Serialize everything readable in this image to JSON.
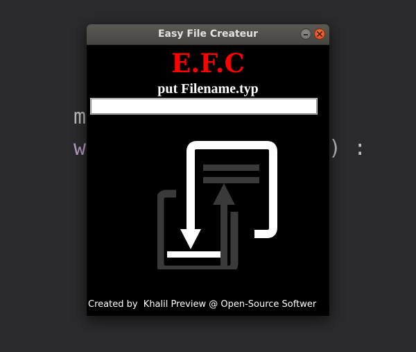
{
  "background": {
    "line1_left": "m",
    "line2_left": "w",
    "line2_right": ") :"
  },
  "window": {
    "title": "Easy File Createur",
    "app_title": "E.F.C",
    "prompt": "put  Filename.typ",
    "filename_input": {
      "value": "",
      "placeholder": ""
    },
    "footer": "Created by  Khalil Preview @ Open-Source Softwer",
    "controls": [
      "minimize-icon",
      "close-icon"
    ]
  },
  "colors": {
    "app_title": "#ff0000",
    "window_bg": "#000000",
    "close_button": "#e0522a",
    "logo_light": "#ffffff",
    "logo_dark": "#3a3a3a"
  }
}
